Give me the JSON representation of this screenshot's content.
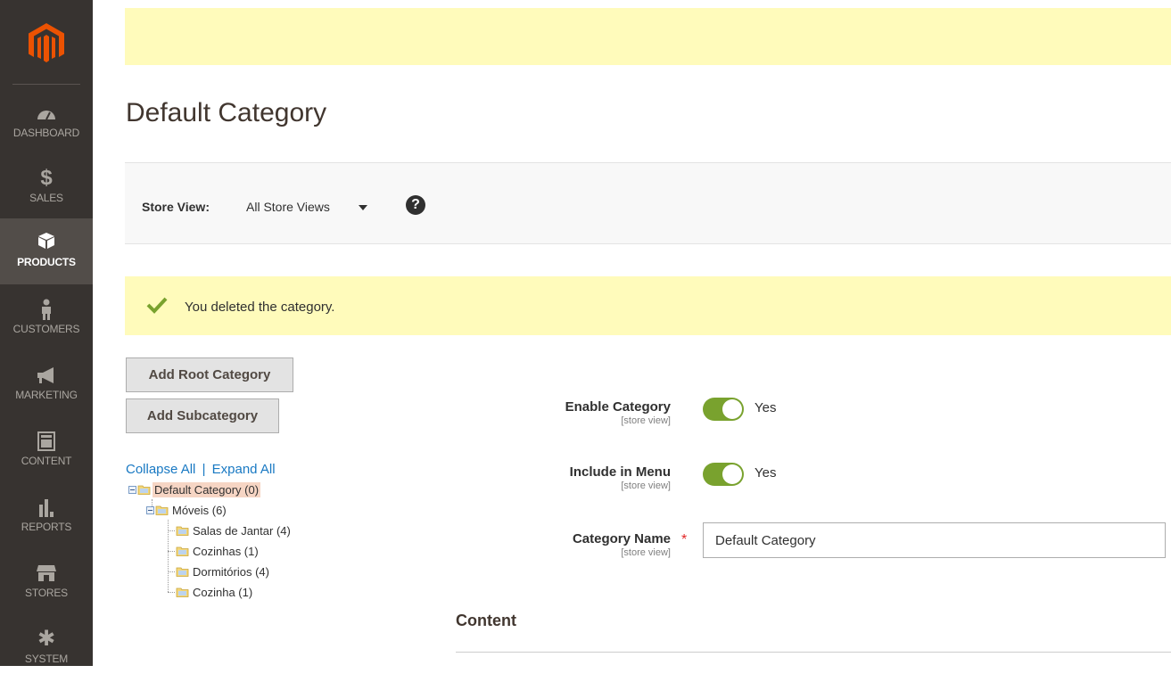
{
  "sidebar": {
    "logo": "magento-logo",
    "items": [
      {
        "label": "DASHBOARD",
        "icon": "dashboard-icon"
      },
      {
        "label": "SALES",
        "icon": "dollar-icon"
      },
      {
        "label": "PRODUCTS",
        "icon": "cube-icon",
        "active": true
      },
      {
        "label": "CUSTOMERS",
        "icon": "person-icon"
      },
      {
        "label": "MARKETING",
        "icon": "megaphone-icon"
      },
      {
        "label": "CONTENT",
        "icon": "layout-icon"
      },
      {
        "label": "REPORTS",
        "icon": "bar-chart-icon"
      },
      {
        "label": "STORES",
        "icon": "store-icon"
      },
      {
        "label": "SYSTEM",
        "icon": "gear-icon"
      }
    ]
  },
  "page": {
    "title": "Default Category"
  },
  "store_switcher": {
    "label": "Store View:",
    "value": "All Store Views",
    "help": "?"
  },
  "message": {
    "text": "You deleted the category."
  },
  "buttons": {
    "add_root": "Add Root Category",
    "add_sub": "Add Subcategory"
  },
  "tree": {
    "collapse_all": "Collapse All",
    "separator": "|",
    "expand_all": "Expand All",
    "nodes": [
      {
        "label": "Default Category (0)",
        "selected": true
      },
      {
        "label": "Móveis (6)"
      },
      {
        "label": "Salas de Jantar (4)"
      },
      {
        "label": "Cozinhas (1)"
      },
      {
        "label": "Dormitórios (4)"
      },
      {
        "label": "Cozinha (1)"
      }
    ]
  },
  "form": {
    "enable": {
      "label": "Enable Category",
      "scope": "[store view]",
      "value": "Yes"
    },
    "menu": {
      "label": "Include in Menu",
      "scope": "[store view]",
      "value": "Yes"
    },
    "name": {
      "label": "Category Name",
      "scope": "[store view]",
      "required": "*",
      "value": "Default Category"
    },
    "section": "Content"
  },
  "colors": {
    "sidebar": "#373330",
    "accent_active": "#524d49",
    "toggle_on": "#79a22e",
    "notice": "#fffbbb",
    "logo": "#eb5202",
    "link": "#1979c3"
  }
}
